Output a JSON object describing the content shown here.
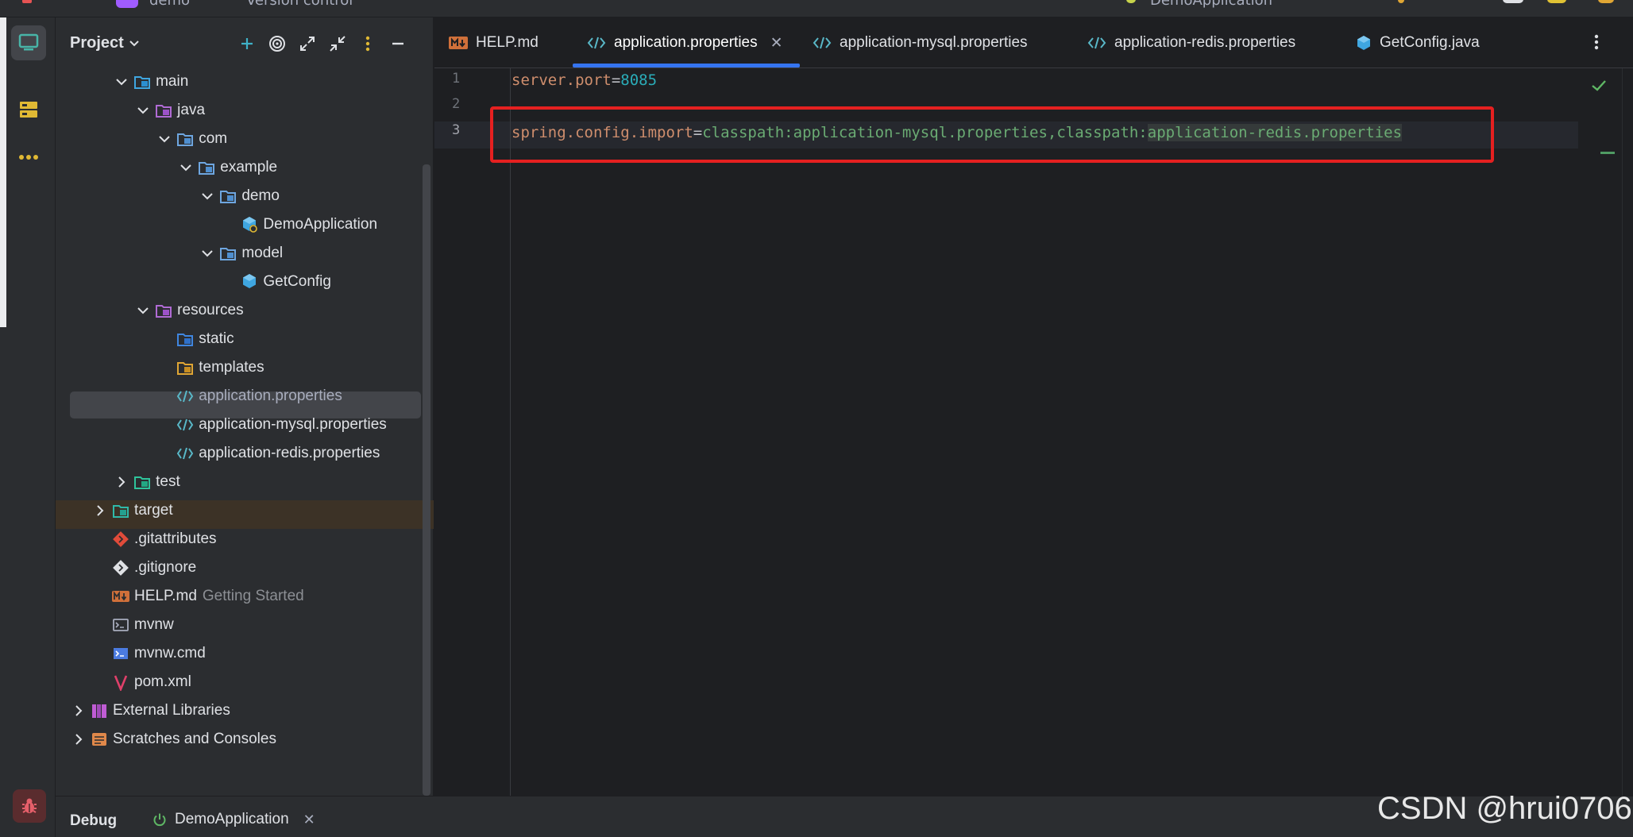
{
  "title_bar": {
    "project_name": "demo",
    "vcs": "Version control",
    "run_config": "DemoApplication"
  },
  "project_panel": {
    "title": "Project",
    "tree": [
      {
        "name": "main",
        "kind": "folder-src",
        "expanded": true
      },
      {
        "name": "java",
        "kind": "folder-java",
        "expanded": true
      },
      {
        "name": "com",
        "kind": "folder-package",
        "expanded": true
      },
      {
        "name": "example",
        "kind": "folder-package",
        "expanded": true
      },
      {
        "name": "demo",
        "kind": "folder-package",
        "expanded": true
      },
      {
        "name": "DemoApplication",
        "kind": "class-spring"
      },
      {
        "name": "model",
        "kind": "folder-package",
        "expanded": true
      },
      {
        "name": "GetConfig",
        "kind": "class"
      },
      {
        "name": "resources",
        "kind": "folder-resources",
        "expanded": true
      },
      {
        "name": "static",
        "kind": "folder-web"
      },
      {
        "name": "templates",
        "kind": "folder-templates"
      },
      {
        "name": "application.properties",
        "kind": "properties",
        "selected": true
      },
      {
        "name": "application-mysql.properties",
        "kind": "properties"
      },
      {
        "name": "application-redis.properties",
        "kind": "properties"
      },
      {
        "name": "test",
        "kind": "folder-test",
        "expanded": false
      },
      {
        "name": "target",
        "kind": "folder-excluded",
        "expanded": false
      },
      {
        "name": ".gitattributes",
        "kind": "git"
      },
      {
        "name": ".gitignore",
        "kind": "gitignore"
      },
      {
        "name": "HELP.md",
        "kind": "markdown",
        "note": "Getting Started"
      },
      {
        "name": "mvnw",
        "kind": "shell"
      },
      {
        "name": "mvnw.cmd",
        "kind": "cmd"
      },
      {
        "name": "pom.xml",
        "kind": "maven"
      },
      {
        "name": "External Libraries",
        "kind": "libraries",
        "expanded": false
      },
      {
        "name": "Scratches and Consoles",
        "kind": "scratches",
        "expanded": false
      }
    ]
  },
  "editor": {
    "tabs": [
      {
        "label": "HELP.md",
        "icon": "markdown-icon"
      },
      {
        "label": "application.properties",
        "icon": "properties-icon",
        "active": true
      },
      {
        "label": "application-mysql.properties",
        "icon": "properties-icon"
      },
      {
        "label": "application-redis.properties",
        "icon": "properties-icon"
      },
      {
        "label": "GetConfig.java",
        "icon": "class-icon"
      }
    ],
    "line_numbers": [
      "1",
      "2",
      "3"
    ],
    "lines": {
      "l1_key": "server.port",
      "l1_eq": "=",
      "l1_val": "8085",
      "l3_key": "spring.config.import",
      "l3_eq": "=",
      "l3_val_a": "classpath:application-mysql.properties,classpath:",
      "l3_val_b": "application-redis.properties"
    }
  },
  "bottom_bar": {
    "debug_label": "Debug",
    "run_tab": "DemoApplication"
  },
  "watermark": "CSDN @hrui0706",
  "colors": {
    "accent": "#3574f0",
    "highlight_box": "#e52020",
    "keyword": "#cf8e6d",
    "number": "#2aacb8",
    "string": "#6aab73"
  }
}
